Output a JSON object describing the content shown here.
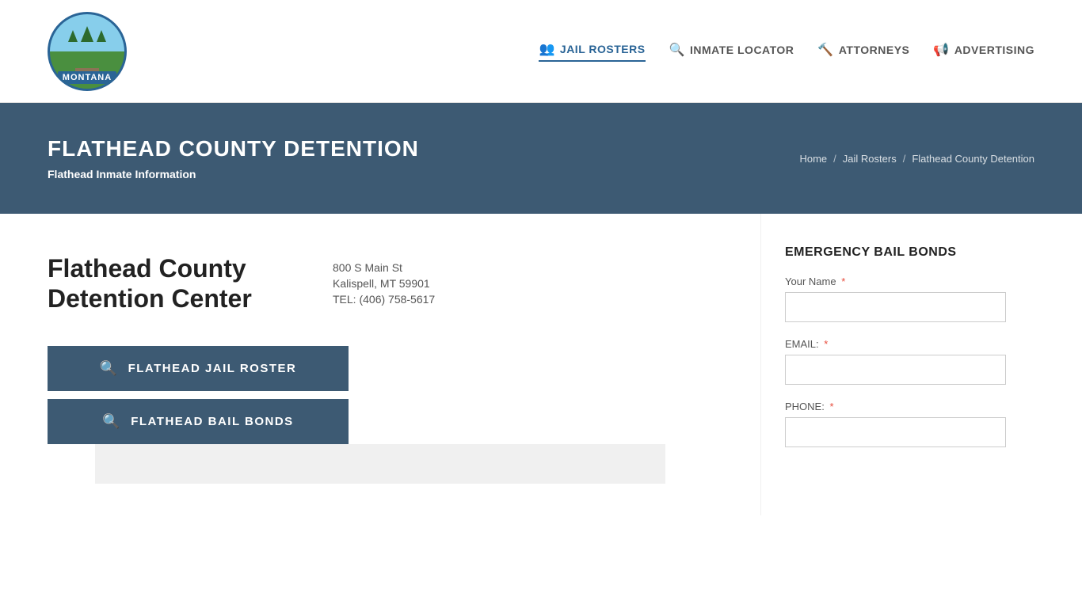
{
  "header": {
    "logo_text": "MONTANA",
    "nav_items": [
      {
        "label": "JAIL ROSTERS",
        "icon": "👥",
        "active": true,
        "id": "jail-rosters"
      },
      {
        "label": "INMATE LOCATOR",
        "icon": "🔍",
        "active": false,
        "id": "inmate-locator"
      },
      {
        "label": "ATTORNEYS",
        "icon": "🔨",
        "active": false,
        "id": "attorneys"
      },
      {
        "label": "ADVERTISING",
        "icon": "📢",
        "active": false,
        "id": "advertising"
      }
    ]
  },
  "hero": {
    "title": "FLATHEAD COUNTY DETENTION",
    "subtitle": "Flathead Inmate Information",
    "breadcrumb": {
      "home": "Home",
      "jail_rosters": "Jail Rosters",
      "current": "Flathead County Detention"
    }
  },
  "facility": {
    "name_line1": "Flathead County",
    "name_line2": "Detention Center",
    "address_line1": "800 S Main St",
    "address_line2": "Kalispell, MT 59901",
    "phone": "TEL: (406) 758-5617",
    "buttons": [
      {
        "label": "FLATHEAD JAIL ROSTER",
        "id": "jail-roster-btn"
      },
      {
        "label": "FLATHEAD BAIL BONDS",
        "id": "bail-bonds-btn"
      }
    ]
  },
  "sidebar": {
    "title": "EMERGENCY BAIL BONDS",
    "fields": [
      {
        "label": "Your Name",
        "required": true,
        "type": "text",
        "id": "your-name"
      },
      {
        "label": "EMAIL:",
        "required": true,
        "type": "email",
        "id": "email"
      },
      {
        "label": "PHONE:",
        "required": true,
        "type": "tel",
        "id": "phone"
      }
    ]
  }
}
